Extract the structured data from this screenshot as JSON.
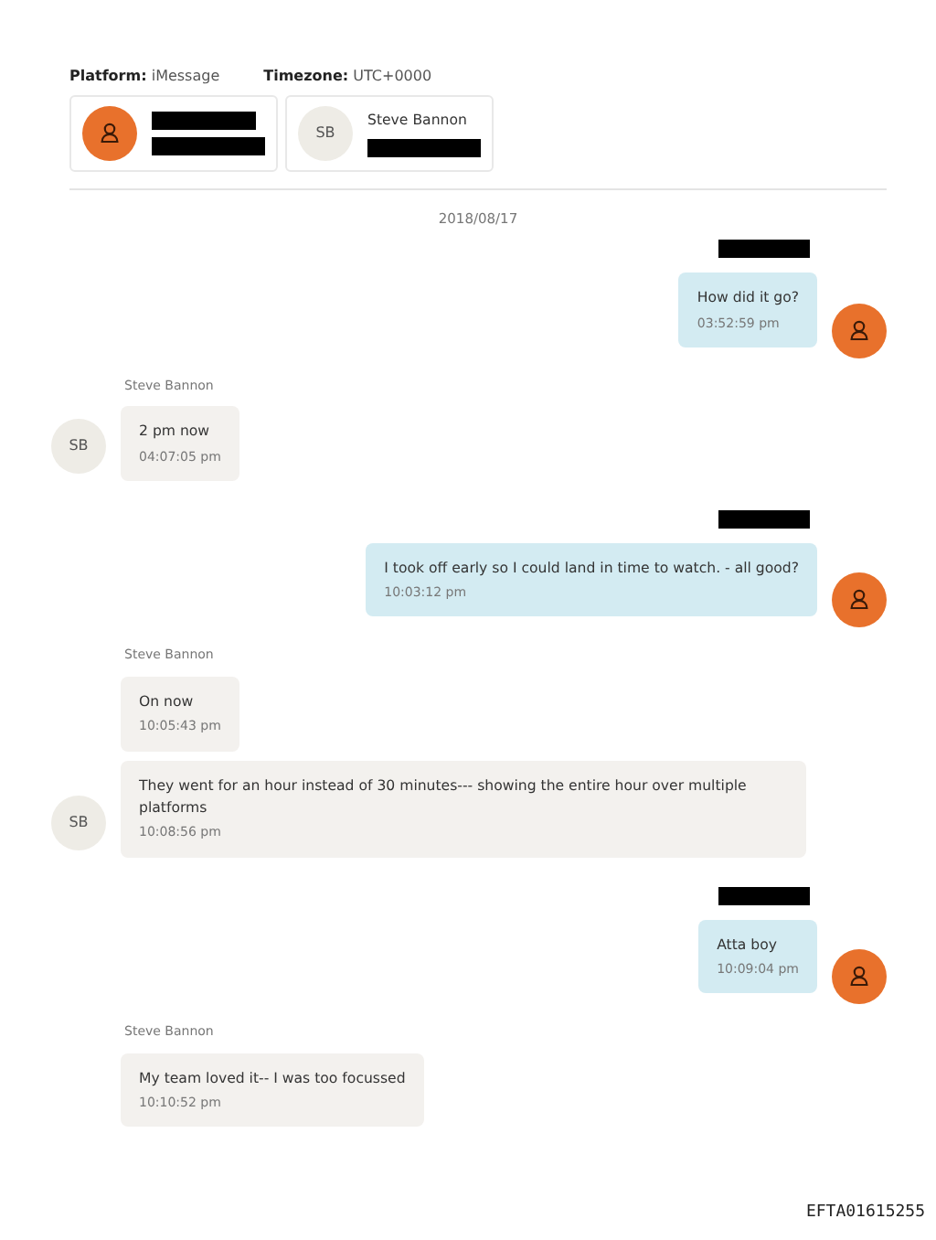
{
  "header": {
    "platform_label": "Platform:",
    "platform": "iMessage",
    "timezone_label": "Timezone:",
    "timezone": "UTC+0000"
  },
  "participants": [
    {
      "kind": "owner",
      "name_redacted": true,
      "detail_redacted": true
    },
    {
      "kind": "contact",
      "initials": "SB",
      "name": "Steve Bannon",
      "detail_redacted": true
    }
  ],
  "date": "2018/08/17",
  "groups": [
    {
      "kind": "outgoing",
      "sender_redacted": true,
      "messages": [
        {
          "text": "How did it go?",
          "time": "03:52:59 pm"
        }
      ]
    },
    {
      "kind": "incoming",
      "sender": "Steve Bannon",
      "initials": "SB",
      "messages": [
        {
          "text": "2 pm now",
          "time": "04:07:05 pm"
        }
      ]
    },
    {
      "kind": "outgoing",
      "sender_redacted": true,
      "messages": [
        {
          "text": "I took off early so I could land in time to watch. - all good?",
          "time": "10:03:12 pm"
        }
      ]
    },
    {
      "kind": "incoming",
      "sender": "Steve Bannon",
      "initials": "SB",
      "messages": [
        {
          "text": "On now",
          "time": "10:05:43 pm"
        },
        {
          "text": "They went for an hour instead of 30 minutes--- showing the entire hour over multiple platforms",
          "time": "10:08:56 pm"
        }
      ]
    },
    {
      "kind": "outgoing",
      "sender_redacted": true,
      "messages": [
        {
          "text": "Atta boy",
          "time": "10:09:04 pm"
        }
      ]
    },
    {
      "kind": "incoming",
      "sender": "Steve Bannon",
      "messages": [
        {
          "text": "My team loved it-- I was too focussed",
          "time": "10:10:52 pm"
        }
      ]
    }
  ],
  "document_id": "EFTA01615255"
}
